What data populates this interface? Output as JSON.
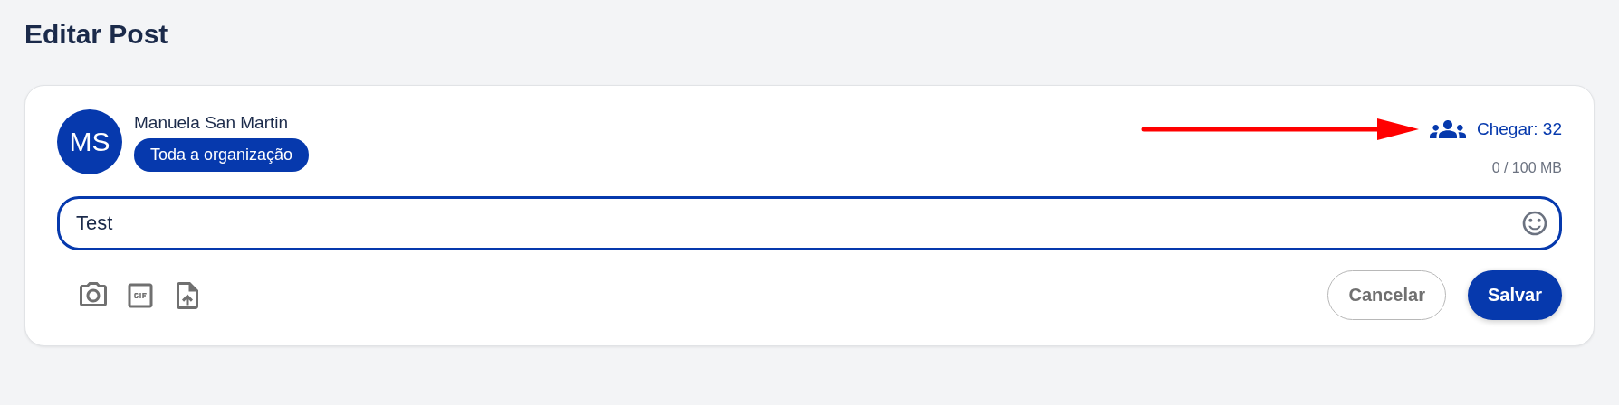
{
  "page": {
    "title": "Editar Post"
  },
  "post": {
    "author": {
      "name": "Manuela San Martin",
      "initials": "MS"
    },
    "audience": "Toda a organização",
    "reach": "Chegar: 32",
    "storage": "0 / 100 MB",
    "text": "Test"
  },
  "attachments": [
    {
      "kind": "photo"
    },
    {
      "kind": "gif"
    },
    {
      "kind": "file"
    }
  ],
  "buttons": [
    {
      "label": "Cancelar",
      "kind": "secondary"
    },
    {
      "label": "Salvar",
      "kind": "primary"
    }
  ]
}
